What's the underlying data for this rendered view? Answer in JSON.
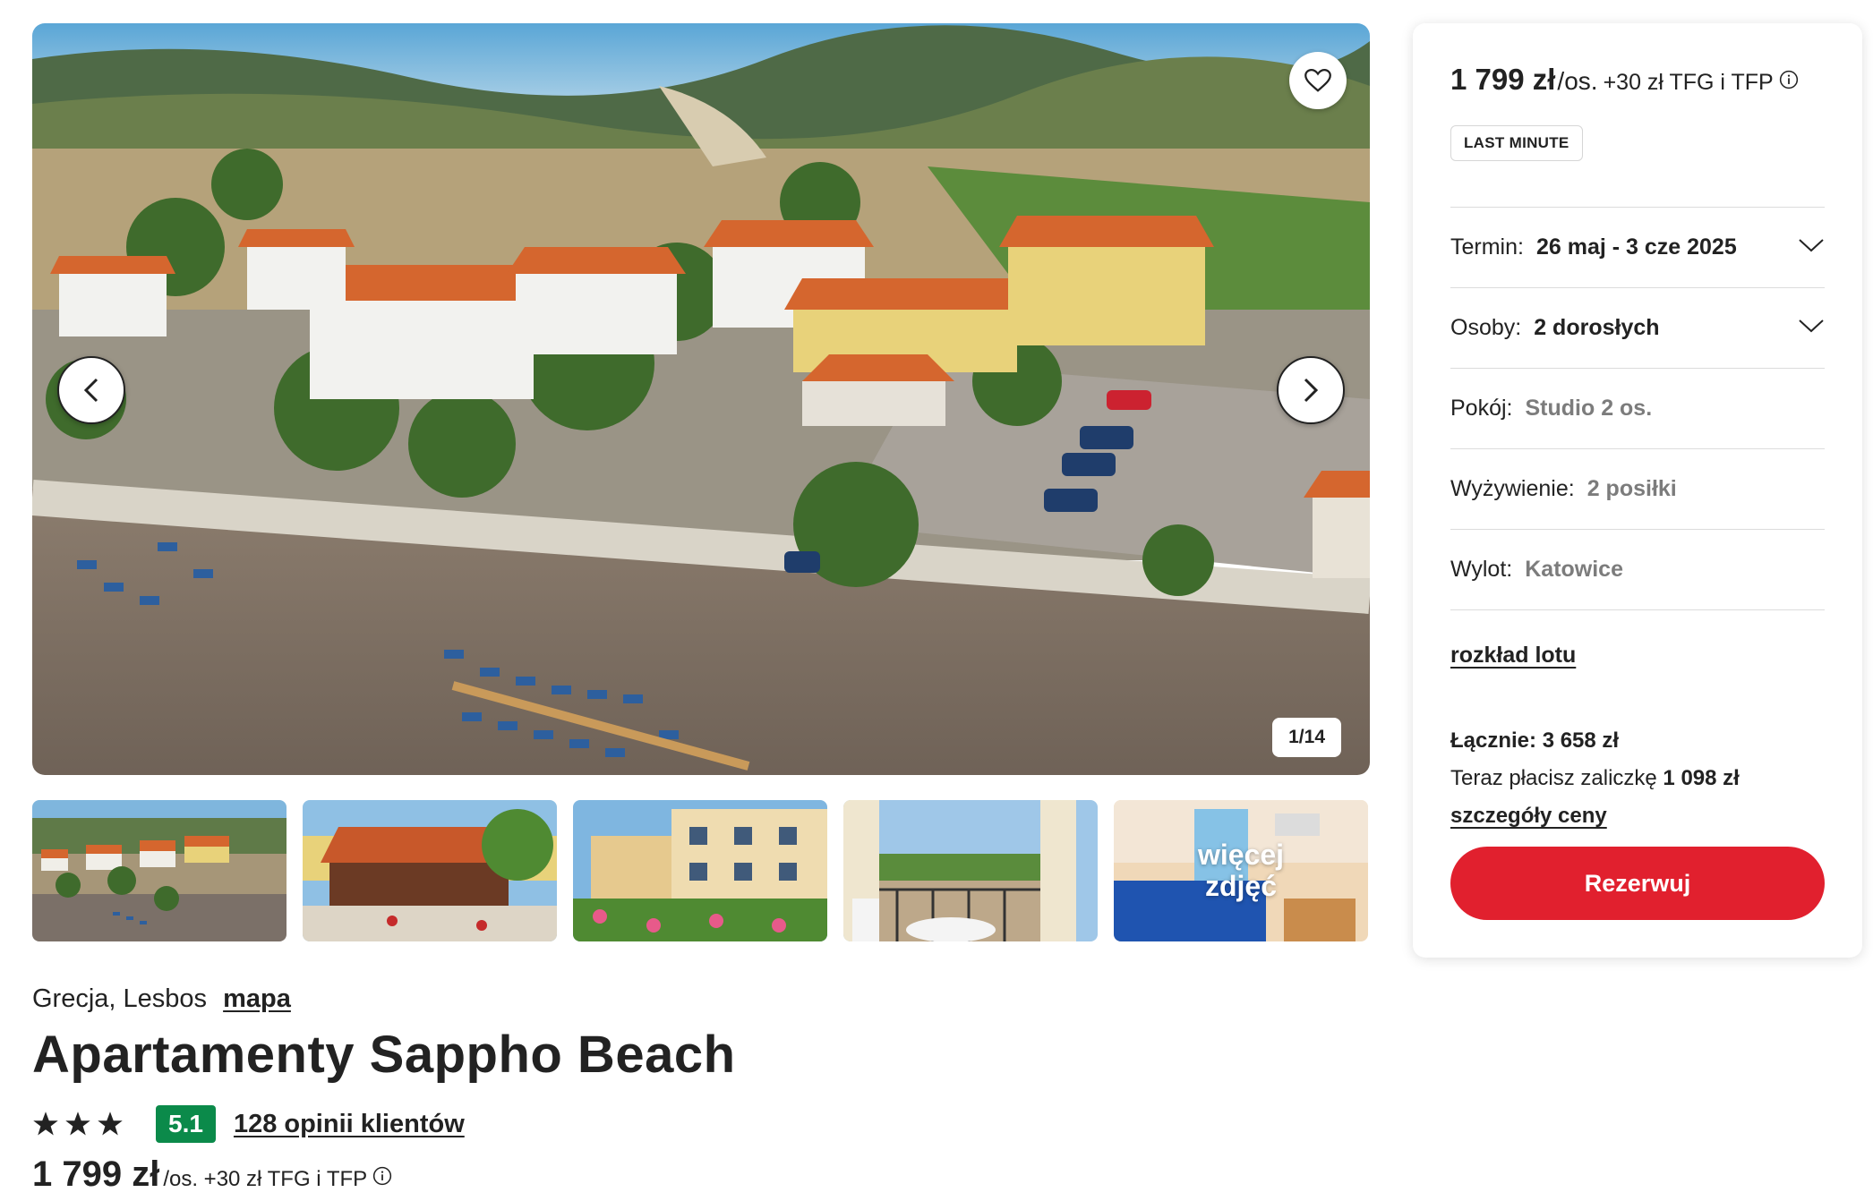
{
  "gallery": {
    "counter": "1/14",
    "thumbnails": [
      {
        "name": "thumb-aerial"
      },
      {
        "name": "thumb-restaurant"
      },
      {
        "name": "thumb-building"
      },
      {
        "name": "thumb-balcony"
      },
      {
        "name": "thumb-room",
        "overlay_label": "więcej zdjęć"
      }
    ],
    "icons": {
      "favorite": "heart-icon",
      "prev": "chevron-left-icon",
      "next": "chevron-right-icon"
    }
  },
  "hotel": {
    "location": "Grecja, Lesbos",
    "map_link": "mapa",
    "name": "Apartamenty Sappho Beach",
    "stars": 3,
    "score": "5.1",
    "reviews_link": "128 opinii klientów",
    "price": "1 799 zł",
    "price_suffix": "/os. +30 zł TFG i TFP"
  },
  "booking": {
    "price_amount": "1 799 zł",
    "price_per": "/os.",
    "price_fee": "+30 zł TFG i TFP",
    "badge": "LAST MINUTE",
    "rows": [
      {
        "label": "Termin:",
        "value": "26 maj - 3 cze 2025",
        "expandable": true
      },
      {
        "label": "Osoby:",
        "value": "2 dorosłych",
        "expandable": true
      },
      {
        "label": "Pokój:",
        "value": "Studio 2 os."
      },
      {
        "label": "Wyżywienie:",
        "value": "2 posiłki"
      },
      {
        "label": "Wylot:",
        "value": "Katowice"
      }
    ],
    "flight_link": "rozkład lotu",
    "total": "Łącznie: 3 658 zł",
    "deposit_text": "Teraz płacisz zaliczkę",
    "deposit_amount": "1 098 zł",
    "price_details_link": "szczegóły ceny",
    "book_button": "Rezerwuj"
  },
  "colors": {
    "accent_red": "#e1202e",
    "score_green": "#0b8a4a",
    "text": "#222222",
    "muted": "#7c7c7c"
  }
}
